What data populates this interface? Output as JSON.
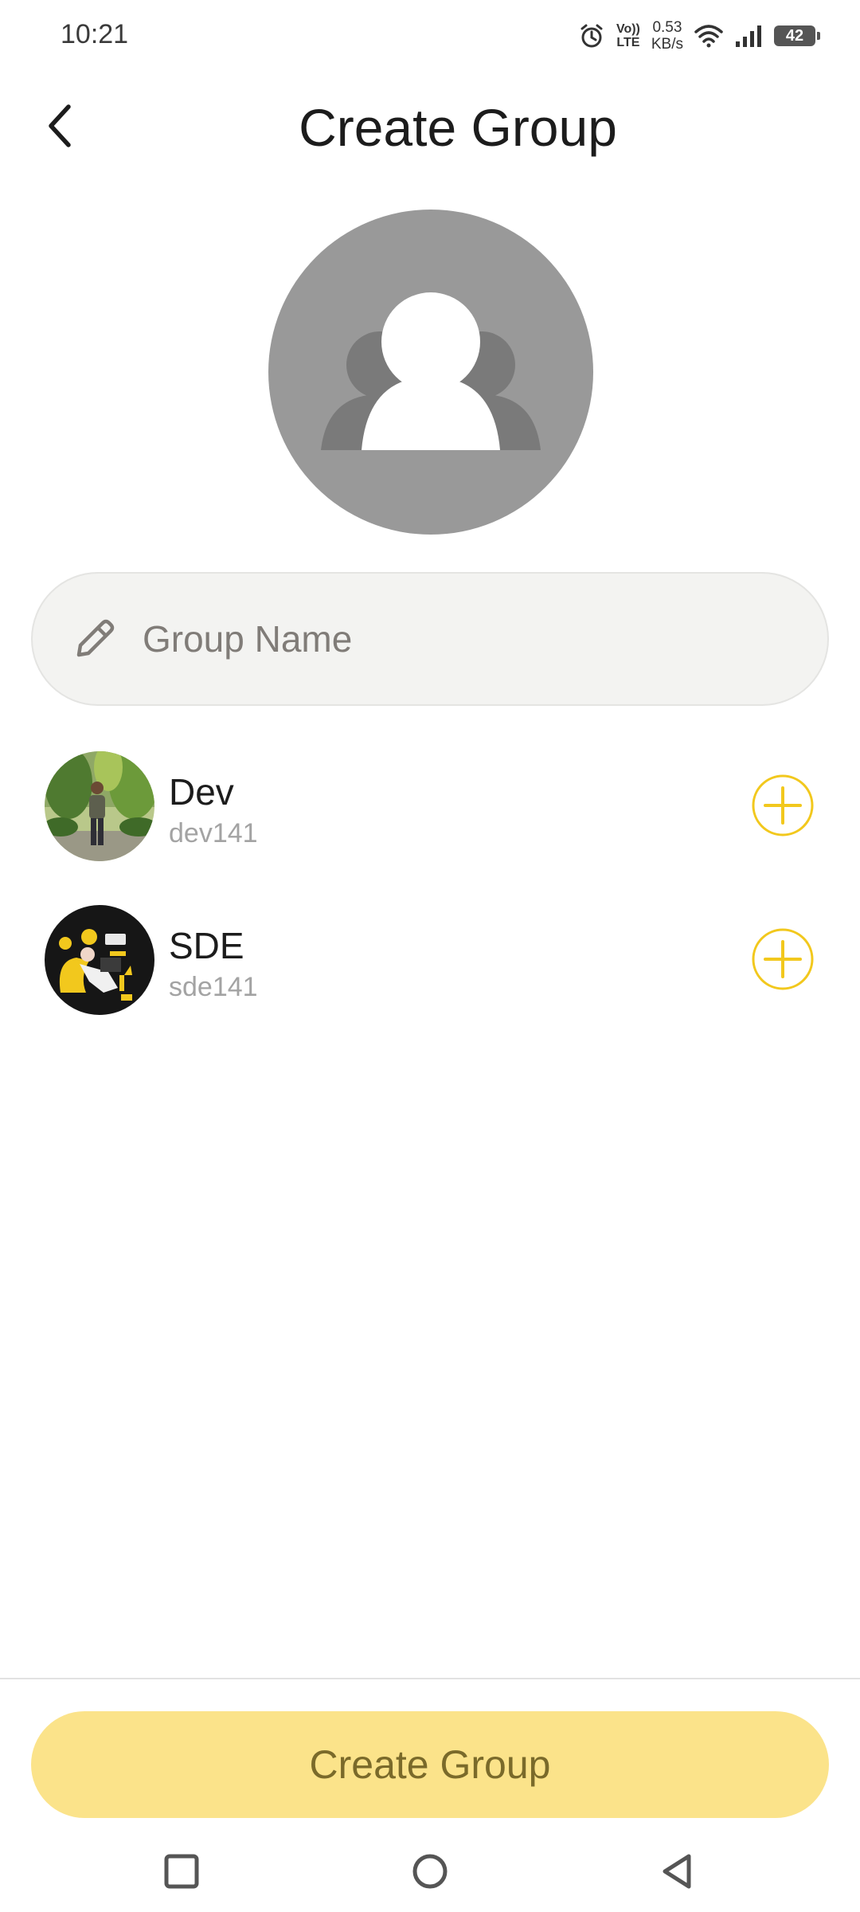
{
  "status_bar": {
    "time": "10:21",
    "volte_line1": "Vo))",
    "volte_line2": "LTE",
    "speed_value": "0.53",
    "speed_unit": "KB/s",
    "battery": "42"
  },
  "header": {
    "title": "Create Group",
    "back_icon": "chevron-left-icon"
  },
  "group_avatar": {
    "icon": "group-people-icon",
    "background": "#999999"
  },
  "group_name_field": {
    "placeholder": "Group Name",
    "value": "",
    "icon": "pencil-icon"
  },
  "contacts": [
    {
      "name": "Dev",
      "handle": "dev141",
      "action_icon": "plus-circle-icon"
    },
    {
      "name": "SDE",
      "handle": "sde141",
      "action_icon": "plus-circle-icon"
    }
  ],
  "create_button": {
    "label": "Create Group"
  },
  "colors": {
    "accent": "#f2c81d",
    "button_bg": "#fbe38a",
    "button_text": "#7a6a2a"
  },
  "nav_bar": {
    "recents_icon": "square-recents-icon",
    "home_icon": "circle-home-icon",
    "back_icon": "triangle-back-icon"
  }
}
